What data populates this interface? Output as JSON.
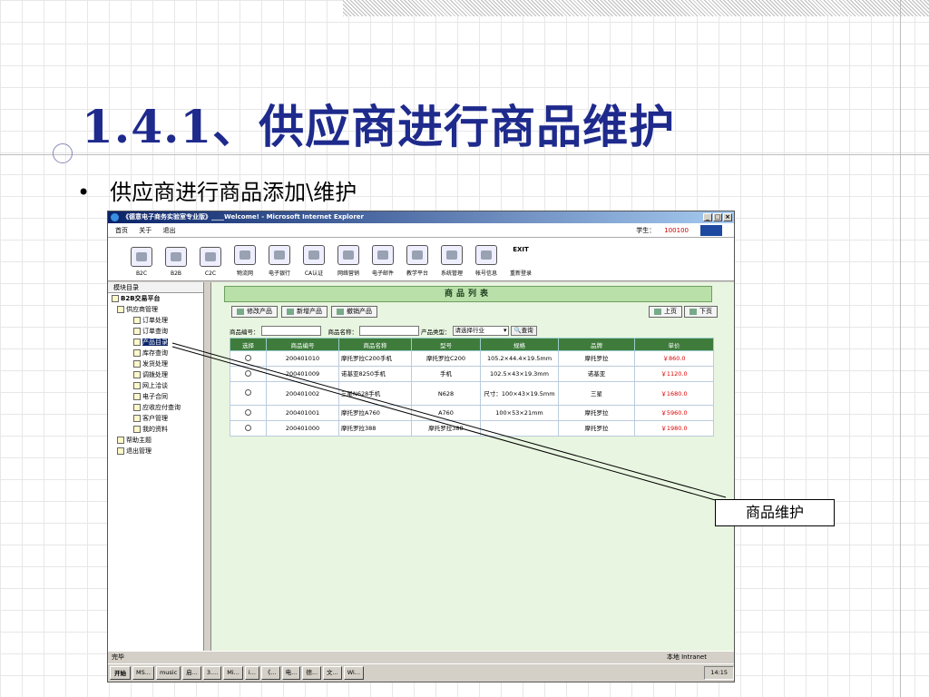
{
  "slide": {
    "title": "1.4.1、供应商进行商品维护",
    "bullet": "•",
    "bullet_text": "供应商进行商品添加\\维护",
    "callout": "商品维护"
  },
  "window": {
    "title": "《德意电子商务实验室专业版》____Welcome! - Microsoft Internet Explorer",
    "controls": [
      "_",
      "□",
      "×"
    ],
    "menu": [
      "首页",
      "关于",
      "退出"
    ],
    "student_label": "学生：",
    "student_id": "100100"
  },
  "toolbar": [
    {
      "label": "B2C",
      "icon": "b2c-icon"
    },
    {
      "label": "B2B",
      "icon": "b2b-icon"
    },
    {
      "label": "C2C",
      "icon": "c2c-icon"
    },
    {
      "label": "物流网",
      "icon": "truck-icon"
    },
    {
      "label": "电子银行",
      "icon": "bank-icon"
    },
    {
      "label": "CA认证",
      "icon": "certificate-icon"
    },
    {
      "label": "网络营销",
      "icon": "network-icon"
    },
    {
      "label": "电子邮件",
      "icon": "mail-icon"
    },
    {
      "label": "教学平台",
      "icon": "teaching-icon"
    },
    {
      "label": "系统管理",
      "icon": "system-icon"
    },
    {
      "label": "帐号信息",
      "icon": "account-icon"
    },
    {
      "label": "重新登录",
      "icon": "exit-icon",
      "icon_text": "EXIT"
    }
  ],
  "sidebar": {
    "header": "模块目录",
    "root": "B2B交易平台",
    "group": "供应商管理",
    "items": [
      "订单处理",
      "订单查询",
      "产品目录",
      "库存查询",
      "发货处理",
      "调拨处理",
      "网上洽谈",
      "电子合同",
      "应收应付查询",
      "客户管理",
      "我的资料"
    ],
    "selected": "产品目录",
    "help": "帮助主题",
    "logout": "退出管理"
  },
  "main": {
    "banner": "商品列表",
    "actions": [
      "修改产品",
      "新增产品",
      "撤销产品"
    ],
    "pager": [
      "上页",
      "下页"
    ],
    "filter": {
      "code_label": "商品编号：",
      "name_label": "商品名称：",
      "type_label": "产品类型：",
      "type_value": "请选择行业",
      "search_button": "查询"
    },
    "columns": [
      "选择",
      "商品编号",
      "商品名称",
      "型号",
      "规格",
      "品牌",
      "单价"
    ],
    "rows": [
      {
        "code": "200401010",
        "name": "摩托罗拉C200手机",
        "model": "摩托罗拉C200",
        "spec": "105.2×44.4×19.5mm",
        "brand": "摩托罗拉",
        "price": "￥860.0"
      },
      {
        "code": "200401009",
        "name": "诺基亚8250手机",
        "model": "手机",
        "spec": "102.5×43×19.3mm",
        "brand": "诺基亚",
        "price": "￥1120.0"
      },
      {
        "code": "200401002",
        "name": "三星N628手机",
        "model": "N628",
        "spec": "尺寸：100×43×19.5mm",
        "brand": "三星",
        "price": "￥1680.0"
      },
      {
        "code": "200401001",
        "name": "摩托罗拉A760",
        "model": "A760",
        "spec": "100×53×21mm",
        "brand": "摩托罗拉",
        "price": "￥5960.0"
      },
      {
        "code": "200401000",
        "name": "摩托罗拉388",
        "model": "摩托罗拉388",
        "spec": "",
        "brand": "摩托罗拉",
        "price": "￥1980.0"
      }
    ]
  },
  "statusbar": {
    "left": "完毕",
    "zone": "本地 Intranet"
  },
  "taskbar": {
    "start": "开始",
    "tasks": [
      "MS...",
      "music",
      "启...",
      "3....",
      "Mi...",
      "i...",
      "《...",
      "电...",
      "德...",
      "文...",
      "Wi..."
    ],
    "time": "14:15"
  }
}
